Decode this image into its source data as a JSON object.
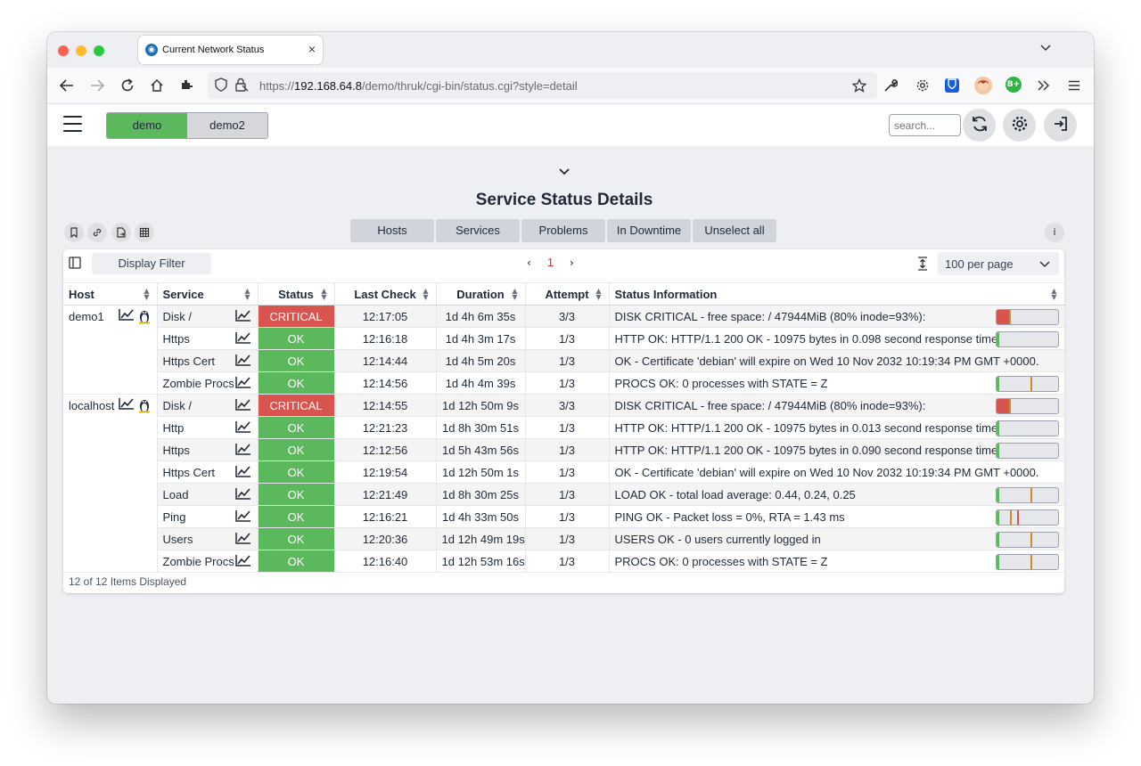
{
  "browser": {
    "tab_title": "Current Network Status",
    "tab_close": "×",
    "url_prefix": "https://",
    "url_host": "192.168.64.8",
    "url_path": "/demo/thruk/cgi-bin/status.cgi?style=detail"
  },
  "header": {
    "sites": [
      "demo",
      "demo2"
    ],
    "search_placeholder": "search..."
  },
  "page": {
    "title": "Service Status Details",
    "filter_tabs": [
      "Hosts",
      "Services",
      "Problems",
      "In Downtime",
      "Unselect all"
    ],
    "info": "i",
    "display_filter": "Display Filter",
    "pager": {
      "prev": "‹",
      "page": "1",
      "next": "›"
    },
    "per_page": "100 per page",
    "footer": "12 of 12 Items Displayed"
  },
  "table": {
    "columns": [
      "Host",
      "Service",
      "Status",
      "Last Check",
      "Duration",
      "Attempt",
      "Status Information"
    ],
    "hosts": [
      {
        "name": "demo1",
        "services": [
          {
            "service": "Disk /",
            "status": "CRITICAL",
            "last_check": "12:17:05",
            "duration": "1d 4h 6m 35s",
            "attempt": "3/3",
            "info": "DISK CRITICAL - free space: / 47944MiB (80% inode=93%):",
            "perf": {
              "fill": 0.2,
              "fill_color": "#d9534f",
              "marker": 0.2,
              "marker_color": "#d08a2e"
            }
          },
          {
            "service": "Https",
            "status": "OK",
            "last_check": "12:16:18",
            "duration": "1d 4h 3m 17s",
            "attempt": "1/3",
            "info": "HTTP OK: HTTP/1.1 200 OK - 10975 bytes in 0.098 second response time",
            "perf": {
              "fill": 0.05,
              "fill_color": "#5cb85c"
            }
          },
          {
            "service": "Https Cert",
            "status": "OK",
            "last_check": "12:14:44",
            "duration": "1d 4h 5m 20s",
            "attempt": "1/3",
            "info": "OK - Certificate 'debian' will expire on Wed 10 Nov 2032 10:19:34 PM GMT +0000.",
            "perf": null
          },
          {
            "service": "Zombie Procs",
            "status": "OK",
            "last_check": "12:14:56",
            "duration": "1d 4h 4m 39s",
            "attempt": "1/3",
            "info": "PROCS OK: 0 processes with STATE = Z",
            "perf": {
              "fill": 0.05,
              "fill_color": "#5cb85c",
              "marker": 0.55,
              "marker_color": "#d08a2e"
            }
          }
        ]
      },
      {
        "name": "localhost",
        "services": [
          {
            "service": "Disk /",
            "status": "CRITICAL",
            "last_check": "12:14:55",
            "duration": "1d 12h 50m 9s",
            "attempt": "3/3",
            "info": "DISK CRITICAL - free space: / 47944MiB (80% inode=93%):",
            "perf": {
              "fill": 0.2,
              "fill_color": "#d9534f",
              "marker": 0.2,
              "marker_color": "#d08a2e"
            }
          },
          {
            "service": "Http",
            "status": "OK",
            "last_check": "12:21:23",
            "duration": "1d 8h 30m 51s",
            "attempt": "1/3",
            "info": "HTTP OK: HTTP/1.1 200 OK - 10975 bytes in 0.013 second response time",
            "perf": {
              "fill": 0.05,
              "fill_color": "#5cb85c"
            }
          },
          {
            "service": "Https",
            "status": "OK",
            "last_check": "12:12:56",
            "duration": "1d 5h 43m 56s",
            "attempt": "1/3",
            "info": "HTTP OK: HTTP/1.1 200 OK - 10975 bytes in 0.090 second response time",
            "perf": {
              "fill": 0.05,
              "fill_color": "#5cb85c"
            }
          },
          {
            "service": "Https Cert",
            "status": "OK",
            "last_check": "12:19:54",
            "duration": "1d 12h 50m 1s",
            "attempt": "1/3",
            "info": "OK - Certificate 'debian' will expire on Wed 10 Nov 2032 10:19:34 PM GMT +0000.",
            "perf": null
          },
          {
            "service": "Load",
            "status": "OK",
            "last_check": "12:21:49",
            "duration": "1d 8h 30m 25s",
            "attempt": "1/3",
            "info": "LOAD OK - total load average: 0.44, 0.24, 0.25",
            "perf": {
              "fill": 0.05,
              "fill_color": "#5cb85c",
              "marker": 0.55,
              "marker_color": "#d08a2e"
            }
          },
          {
            "service": "Ping",
            "status": "OK",
            "last_check": "12:16:21",
            "duration": "1d 4h 33m 50s",
            "attempt": "1/3",
            "info": "PING OK - Packet loss = 0%, RTA = 1.43 ms",
            "perf": {
              "fill": 0.05,
              "fill_color": "#5cb85c",
              "marker": 0.22,
              "marker_color": "#d08a2e",
              "marker2": 0.33,
              "marker2_color": "#d9534f"
            }
          },
          {
            "service": "Users",
            "status": "OK",
            "last_check": "12:20:36",
            "duration": "1d 12h 49m 19s",
            "attempt": "1/3",
            "info": "USERS OK - 0 users currently logged in",
            "perf": {
              "fill": 0.05,
              "fill_color": "#5cb85c",
              "marker": 0.55,
              "marker_color": "#d08a2e"
            }
          },
          {
            "service": "Zombie Procs",
            "status": "OK",
            "last_check": "12:16:40",
            "duration": "1d 12h 53m 16s",
            "attempt": "1/3",
            "info": "PROCS OK: 0 processes with STATE = Z",
            "perf": {
              "fill": 0.05,
              "fill_color": "#5cb85c",
              "marker": 0.55,
              "marker_color": "#d08a2e"
            }
          }
        ]
      }
    ]
  },
  "colors": {
    "ok": "#5cb85c",
    "critical": "#d9534f",
    "pager_active": "#dc2626"
  }
}
